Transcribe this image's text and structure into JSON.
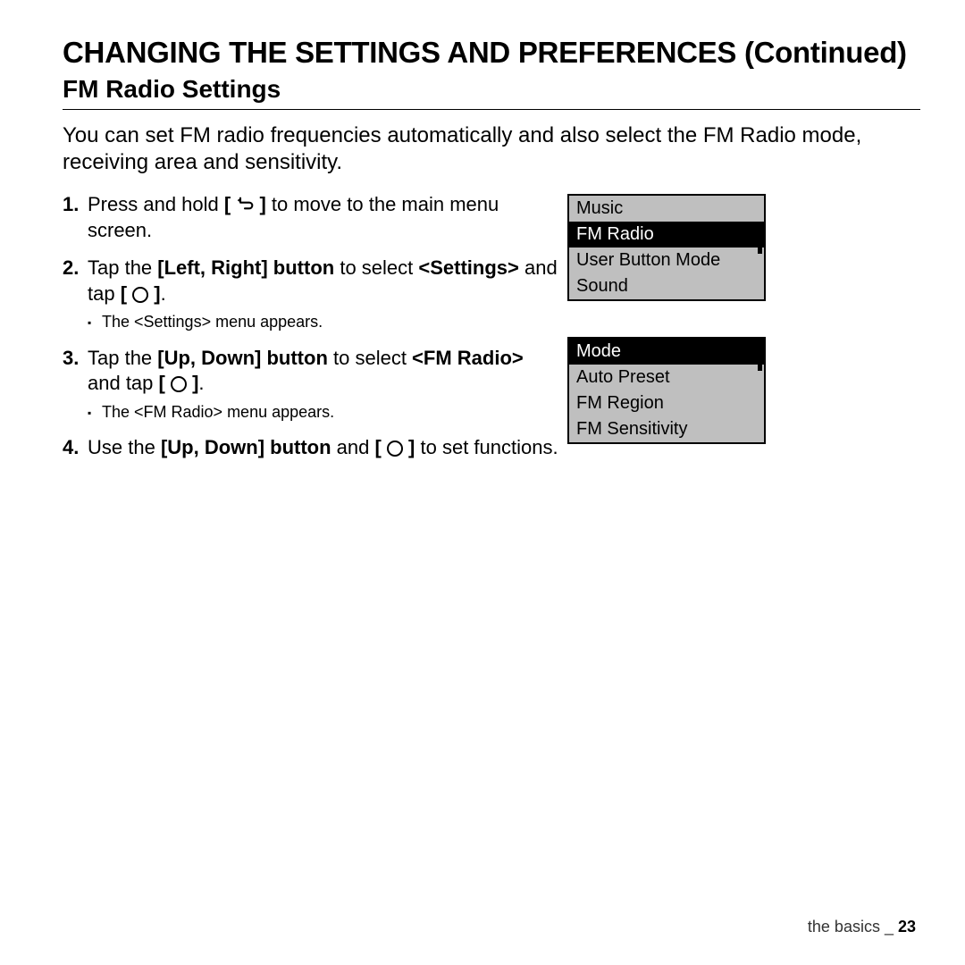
{
  "page_title": "CHANGING THE SETTINGS AND PREFERENCES (Continued)",
  "section_heading": "FM Radio Settings",
  "intro": "You can set FM radio frequencies automatically and also select the FM Radio mode, receiving area and sensitivity.",
  "steps": {
    "s1_a": "Press and hold ",
    "s1_b": " to move to the main menu screen.",
    "s2_a": "Tap the ",
    "s2_b": "[Left, Right] button",
    "s2_c": " to select ",
    "s2_d": "<Settings>",
    "s2_e": " and tap ",
    "s2_f": ".",
    "s2_sub": "The <Settings> menu appears.",
    "s3_a": "Tap the ",
    "s3_b": "[Up, Down] button",
    "s3_c": " to select ",
    "s3_d": "<FM Radio>",
    "s3_e": " and tap ",
    "s3_f": ".",
    "s3_sub": "The <FM Radio> menu appears.",
    "s4_a": "Use the ",
    "s4_b": "[Up, Down] button",
    "s4_c": " and ",
    "s4_d": " to set functions."
  },
  "menu1": {
    "items": [
      "Music",
      "FM Radio",
      "User Button Mode",
      "Sound"
    ],
    "selected_index": 1,
    "thumb_top_pct": 24,
    "thumb_height_pct": 32
  },
  "menu2": {
    "items": [
      "Mode",
      "Auto Preset",
      "FM Region",
      "FM Sensitivity"
    ],
    "selected_index": 0,
    "thumb_top_pct": 0,
    "thumb_height_pct": 30
  },
  "footer_section": "the basics",
  "footer_sep": " _ ",
  "footer_page": "23"
}
